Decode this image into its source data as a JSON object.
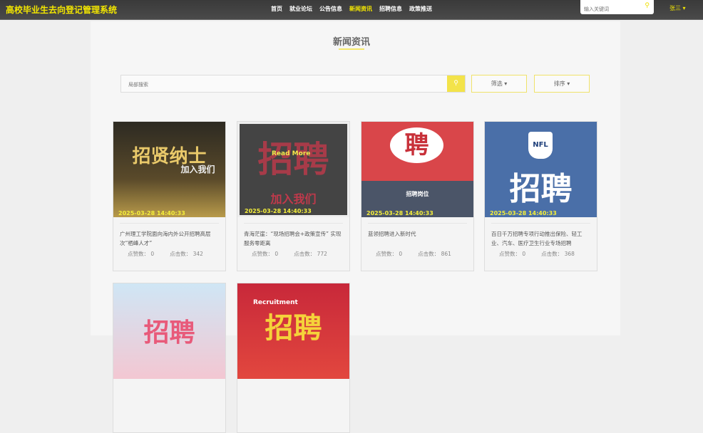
{
  "header": {
    "logo": "高校毕业生去向登记管理系统",
    "nav": [
      "首页",
      "就业论坛",
      "公告信息",
      "新闻资讯",
      "招聘信息",
      "政策推送"
    ],
    "active": 3,
    "search_placeholder": "输入关键词",
    "user": "张三 ▾"
  },
  "main": {
    "title": "新闻资讯",
    "search_placeholder": "局部搜索",
    "filter_label": "筛选 ▾",
    "sort_label": "排序 ▾",
    "likes_label": "点赞数：",
    "clicks_label": "点击数："
  },
  "cards": [
    {
      "img_text": "招贤纳士",
      "img_sub": "加入我们",
      "date": "2025-03-28 14:40:33",
      "title": "广州理工学院面向海内外公开招聘高层次“栖峰人才”",
      "likes": "0",
      "clicks": "342"
    },
    {
      "img_text": "招聘",
      "img_sub": "加入我们",
      "read_more": "Read More",
      "date": "2025-03-28 14:40:33",
      "title": "青海茫崖：“现场招聘会+政策宣传” 实现服务零距离",
      "likes": "0",
      "clicks": "772"
    },
    {
      "img_text": "聘",
      "img_sub": "招聘岗位",
      "date": "2025-03-28 14:40:33",
      "title": "蓝领招聘进入新时代",
      "likes": "0",
      "clicks": "861"
    },
    {
      "img_text": "招聘",
      "img_sub": "NFL",
      "date": "2025-03-28 14:40:33",
      "title": "百日千万招聘专项行动推出保险、轻工业、汽车、医疗卫生行业专场招聘",
      "likes": "0",
      "clicks": "368"
    },
    {
      "img_text": "招聘"
    },
    {
      "img_text": "招聘",
      "img_sub": "Recruitment"
    }
  ]
}
